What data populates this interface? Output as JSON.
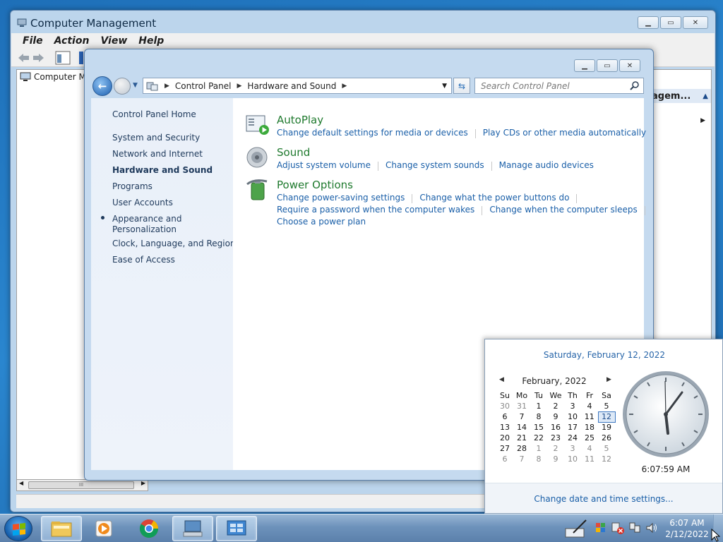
{
  "computer_management": {
    "title": "Computer Management",
    "menu": [
      "File",
      "Action",
      "View",
      "Help"
    ],
    "tree_root": "Computer Ma",
    "right_header": "agem...",
    "scroll_grip": "III"
  },
  "control_panel": {
    "breadcrumb": [
      "Control Panel",
      "Hardware and Sound"
    ],
    "search_placeholder": "Search Control Panel",
    "sidebar": [
      "Control Panel Home",
      "System and Security",
      "Network and Internet",
      "Hardware and Sound",
      "Programs",
      "User Accounts",
      "Appearance and",
      "Personalization",
      "Clock, Language, and Region",
      "Ease of Access"
    ],
    "categories": {
      "autoplay": {
        "title": "AutoPlay",
        "links": [
          "Change default settings for media or devices",
          "Play CDs or other media automatically"
        ]
      },
      "sound": {
        "title": "Sound",
        "links": [
          "Adjust system volume",
          "Change system sounds",
          "Manage audio devices"
        ]
      },
      "power": {
        "title": "Power Options",
        "links": [
          "Change power-saving settings",
          "Change what the power buttons do",
          "Require a password when the computer wakes",
          "Change when the computer sleeps",
          "Choose a power plan"
        ]
      }
    }
  },
  "flyout": {
    "long_date": "Saturday, February 12, 2022",
    "month": "February, 2022",
    "weekdays": [
      "Su",
      "Mo",
      "Tu",
      "We",
      "Th",
      "Fr",
      "Sa"
    ],
    "weeks": [
      [
        "30",
        "31",
        "1",
        "2",
        "3",
        "4",
        "5"
      ],
      [
        "6",
        "7",
        "8",
        "9",
        "10",
        "11",
        "12"
      ],
      [
        "13",
        "14",
        "15",
        "16",
        "17",
        "18",
        "19"
      ],
      [
        "20",
        "21",
        "22",
        "23",
        "24",
        "25",
        "26"
      ],
      [
        "27",
        "28",
        "1",
        "2",
        "3",
        "4",
        "5"
      ],
      [
        "6",
        "7",
        "8",
        "9",
        "10",
        "11",
        "12"
      ]
    ],
    "time": "6:07:59 AM",
    "footer_link": "Change date and time settings..."
  },
  "taskbar": {
    "time": "6:07 AM",
    "date": "2/12/2022"
  },
  "colors": {
    "link": "#1a5fa8",
    "category_title": "#1f7a2e",
    "today_border": "#3d77c0"
  }
}
